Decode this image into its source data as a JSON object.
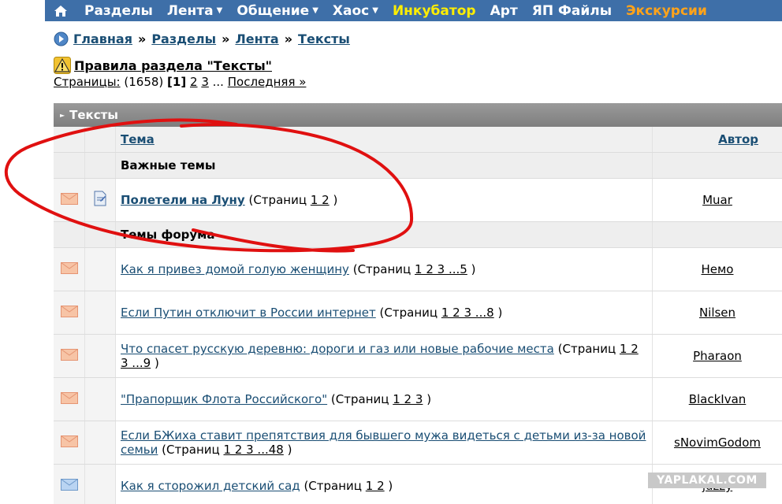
{
  "nav": {
    "items": [
      {
        "label": "Разделы",
        "caret": false,
        "color": "white"
      },
      {
        "label": "Лента",
        "caret": true,
        "color": "white"
      },
      {
        "label": "Общение",
        "caret": true,
        "color": "white"
      },
      {
        "label": "Хаос",
        "caret": true,
        "color": "white"
      },
      {
        "label": "Инкубатор",
        "caret": false,
        "color": "yellow"
      },
      {
        "label": "Арт",
        "caret": false,
        "color": "white"
      },
      {
        "label": "ЯП Файлы",
        "caret": false,
        "color": "white"
      },
      {
        "label": "Экскурсии",
        "caret": false,
        "color": "orange"
      }
    ],
    "caret_glyph": "▼"
  },
  "breadcrumb": {
    "items": [
      "Главная",
      "Разделы",
      "Лента",
      "Тексты"
    ],
    "separator": "»"
  },
  "rules": {
    "label": "Правила раздела \"Тексты\""
  },
  "pages": {
    "label": "Страницы:",
    "count": "(1658)",
    "current": "[1]",
    "p2": "2",
    "p3": "3",
    "ellipsis": "...",
    "last": "Последняя »"
  },
  "table": {
    "section_title": "Тексты",
    "col_topic": "Тема",
    "col_author": "Автор",
    "group_important": "Важные темы",
    "group_forum": "Темы форума",
    "pages_prefix": "(Страниц",
    "pages_suffix": ")",
    "important": [
      {
        "title": "Полетели на Луну",
        "pages": "1 2",
        "author": "Muar"
      }
    ],
    "topics": [
      {
        "title": "Как я привез домой голую женщину",
        "pages": "1 2 3 ...5",
        "author": "Немо",
        "icon": "orange"
      },
      {
        "title": "Если Путин отключит в России интернет",
        "pages": "1 2 3 ...8",
        "author": "Nilsen",
        "icon": "orange"
      },
      {
        "title": "Что спасет русскую деревню: дороги и газ или новые рабочие места",
        "pages": "1 2 3 ...9",
        "author": "Pharaon",
        "icon": "orange"
      },
      {
        "title": "\"Прапорщик Флота Российского\"",
        "pages": "1 2 3",
        "author": "BlackIvan",
        "icon": "orange"
      },
      {
        "title": "Если БЖиха ставит препятствия для бывшего мужа видеться с детьми из-за новой семьи",
        "pages": "1 2 3 ...48",
        "author": "sNovimGodom",
        "icon": "orange"
      },
      {
        "title": "Как я сторожил детский сад",
        "pages": "1 2",
        "author": "juzzy",
        "icon": "blue"
      }
    ]
  },
  "watermark": "YAPLAKAL.COM",
  "colors": {
    "nav_bg": "#3e6fa8",
    "link": "#1a4e74",
    "accent_yellow": "#ffee00",
    "accent_orange": "#ffa31a",
    "scribble": "#e01010"
  }
}
